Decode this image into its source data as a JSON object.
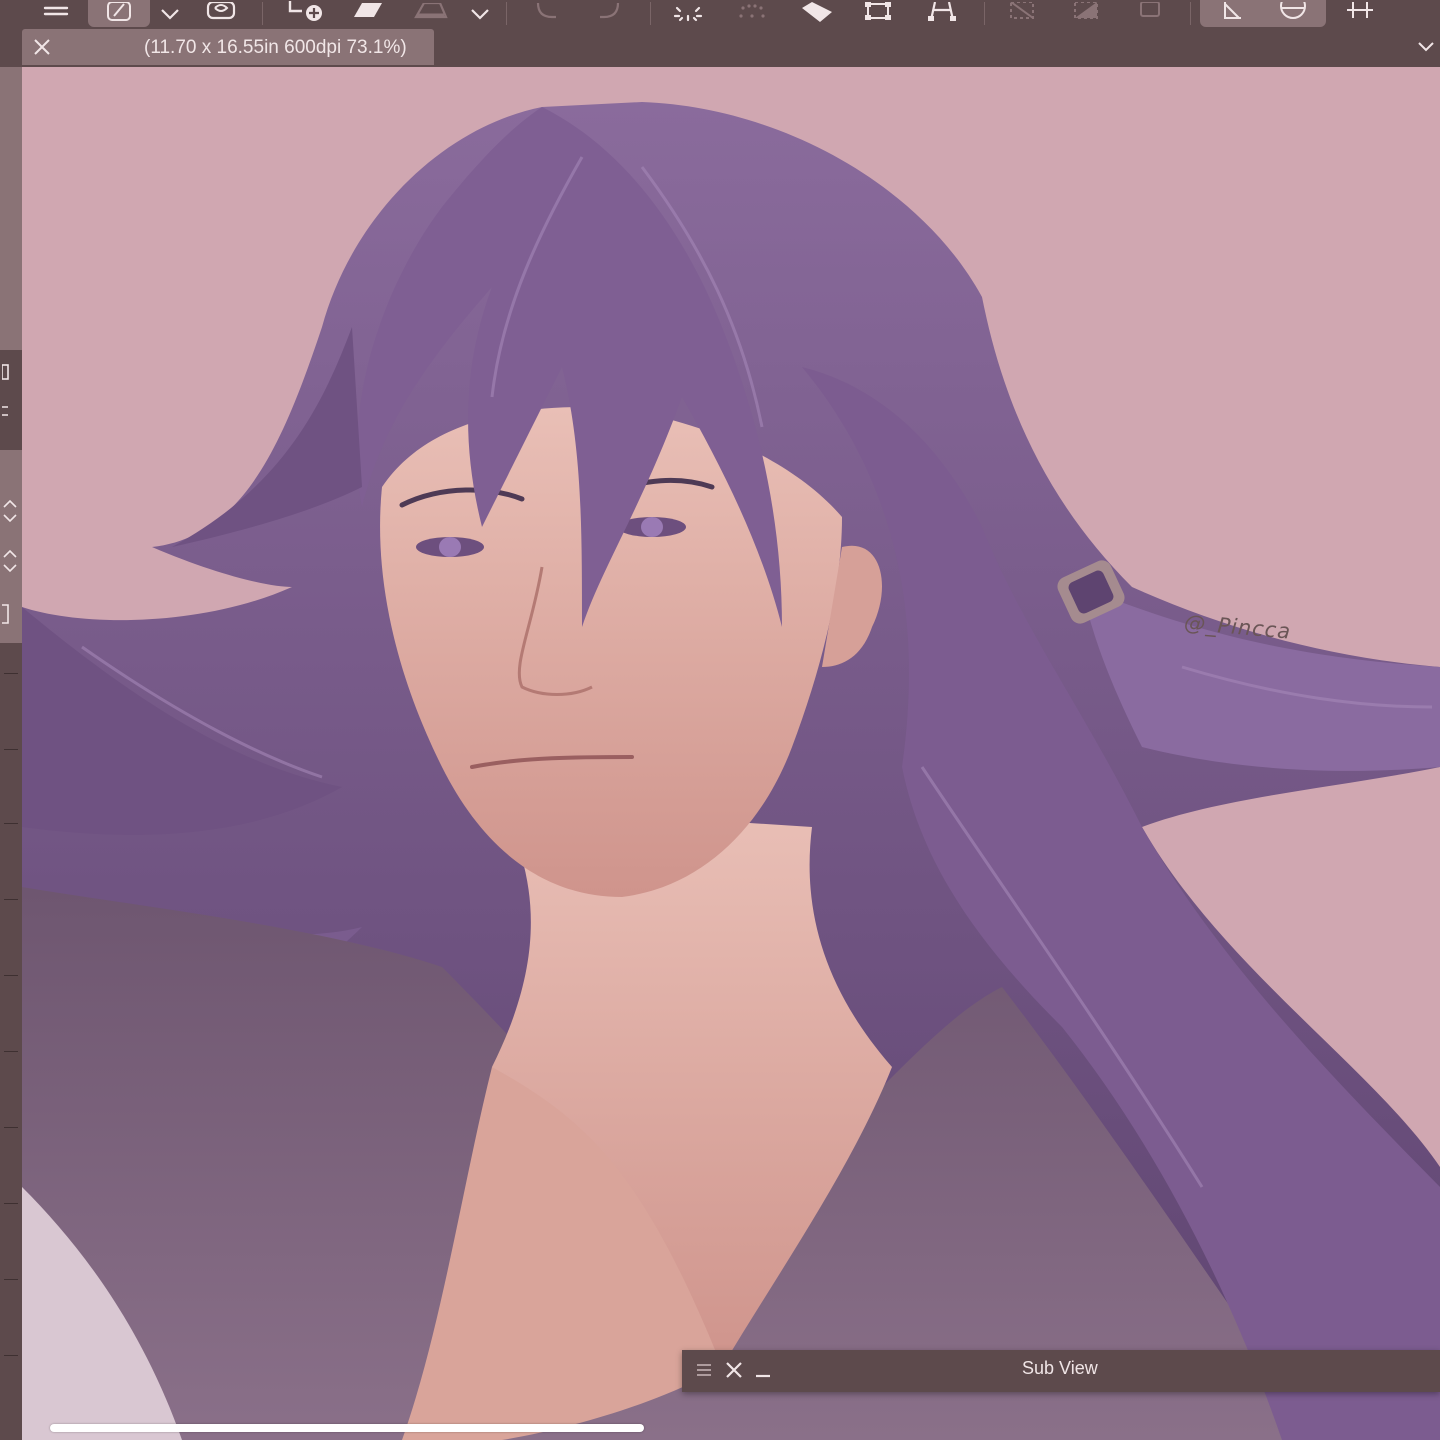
{
  "document_tab": {
    "title": "(11.70 x 16.55in 600dpi 73.1%)"
  },
  "toolbar": {
    "buttons": [
      {
        "name": "menu-icon"
      },
      {
        "name": "brush-tool-icon",
        "active": true
      },
      {
        "name": "chevron-down-icon"
      },
      {
        "name": "lasso-icon"
      },
      {
        "name": "add-layer-icon"
      },
      {
        "name": "eraser-icon"
      },
      {
        "name": "fill-icon"
      },
      {
        "name": "chevron-down-icon"
      },
      {
        "name": "undo-icon"
      },
      {
        "name": "redo-icon"
      },
      {
        "name": "sparkle-icon"
      },
      {
        "name": "dotted-sparkle-icon"
      },
      {
        "name": "pen-fill-icon"
      },
      {
        "name": "transform-icon"
      },
      {
        "name": "perspective-icon"
      },
      {
        "name": "deselect-icon"
      },
      {
        "name": "invert-selection-icon"
      },
      {
        "name": "crop-selection-icon"
      },
      {
        "name": "ruler-icon",
        "active": true
      },
      {
        "name": "circle-ruler-icon",
        "active": true
      },
      {
        "name": "grid-icon"
      }
    ]
  },
  "canvas": {
    "signature": "@_Pincca",
    "background_color": "#d0a7b1"
  },
  "subview": {
    "title": "Sub View"
  },
  "colors": {
    "ui_dark": "#5d4a4c",
    "ui_light": "#8a7376",
    "hair": "#7b5c8c",
    "skin": "#e4b4ad"
  }
}
